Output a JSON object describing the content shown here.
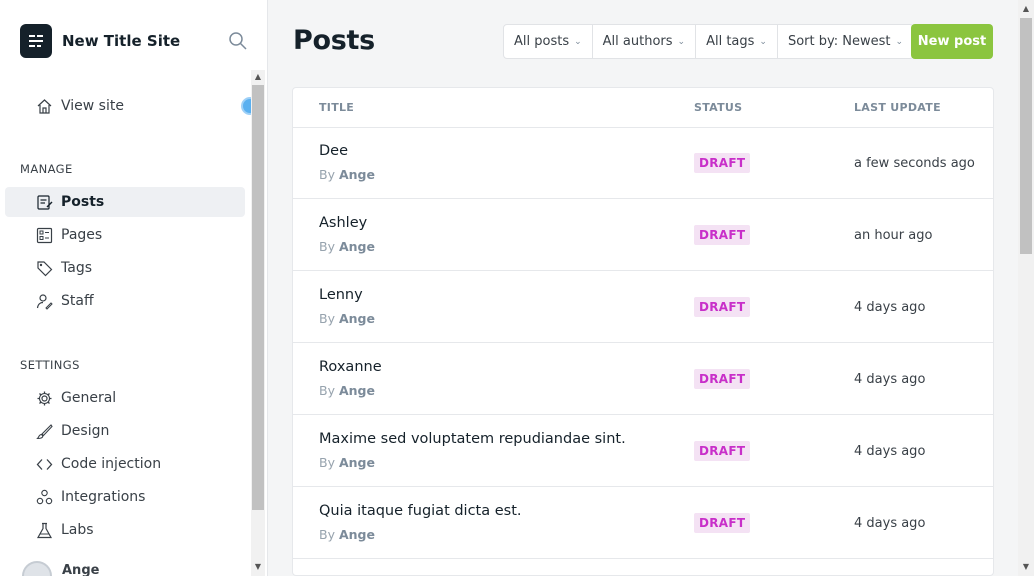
{
  "site": {
    "title": "New Title Site"
  },
  "sidebar": {
    "view_site": "View site",
    "manage_label": "MANAGE",
    "manage_items": [
      {
        "label": "Posts",
        "icon": "posts-icon"
      },
      {
        "label": "Pages",
        "icon": "pages-icon"
      },
      {
        "label": "Tags",
        "icon": "tag-icon"
      },
      {
        "label": "Staff",
        "icon": "staff-icon"
      }
    ],
    "settings_label": "SETTINGS",
    "settings_items": [
      {
        "label": "General",
        "icon": "gear-icon"
      },
      {
        "label": "Design",
        "icon": "brush-icon"
      },
      {
        "label": "Code injection",
        "icon": "code-icon"
      },
      {
        "label": "Integrations",
        "icon": "integrations-icon"
      },
      {
        "label": "Labs",
        "icon": "flask-icon"
      }
    ],
    "user_name": "Ange"
  },
  "header": {
    "title": "Posts",
    "filters": [
      "All posts",
      "All authors",
      "All tags",
      "Sort by: Newest"
    ],
    "new_post": "New post"
  },
  "table": {
    "columns": [
      "TITLE",
      "STATUS",
      "LAST UPDATE"
    ],
    "by_prefix": "By",
    "rows": [
      {
        "title": "Dee",
        "author": "Ange",
        "status": "DRAFT",
        "updated": "a few seconds ago"
      },
      {
        "title": "Ashley",
        "author": "Ange",
        "status": "DRAFT",
        "updated": "an hour ago"
      },
      {
        "title": "Lenny",
        "author": "Ange",
        "status": "DRAFT",
        "updated": "4 days ago"
      },
      {
        "title": "Roxanne",
        "author": "Ange",
        "status": "DRAFT",
        "updated": "4 days ago"
      },
      {
        "title": "Maxime sed voluptatem repudiandae sint.",
        "author": "Ange",
        "status": "DRAFT",
        "updated": "4 days ago"
      },
      {
        "title": "Quia itaque fugiat dicta est.",
        "author": "Ange",
        "status": "DRAFT",
        "updated": "4 days ago"
      }
    ]
  },
  "colors": {
    "accent_green": "#8bc53f",
    "draft_text": "#c82fc9",
    "draft_bg": "#f4e2f4"
  }
}
